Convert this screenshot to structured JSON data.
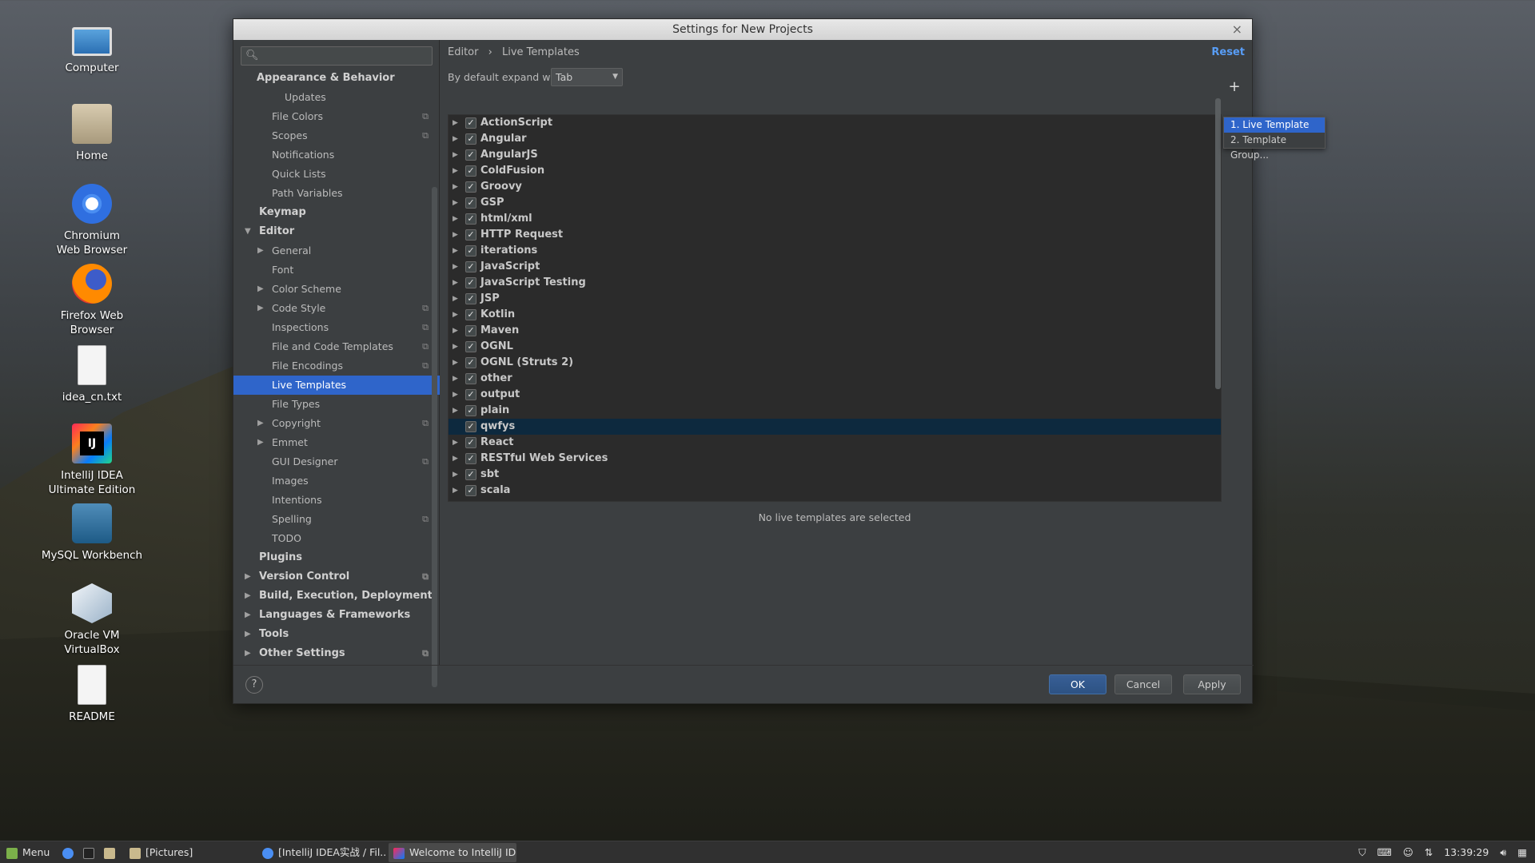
{
  "desktop": {
    "icons": [
      {
        "label": "Computer",
        "icon": "computer-icon"
      },
      {
        "label": "Home",
        "icon": "home-folder-icon"
      },
      {
        "label": "Chromium Web Browser",
        "icon": "chromium-icon"
      },
      {
        "label": "Firefox Web Browser",
        "icon": "firefox-icon"
      },
      {
        "label": "idea_cn.txt",
        "icon": "text-file-icon"
      },
      {
        "label": "IntelliJ IDEA Ultimate Edition",
        "icon": "intellij-icon"
      },
      {
        "label": "MySQL Workbench",
        "icon": "mysql-workbench-icon"
      },
      {
        "label": "Oracle VM VirtualBox",
        "icon": "virtualbox-icon"
      },
      {
        "label": "README",
        "icon": "text-file-icon"
      }
    ]
  },
  "dialog": {
    "title": "Settings for New Projects",
    "close_glyph": "×",
    "search": {
      "placeholder": ""
    },
    "tree": {
      "appearance": "Appearance & Behavior",
      "updates": "Updates",
      "file_colors": "File Colors",
      "scopes": "Scopes",
      "notifications": "Notifications",
      "quick_lists": "Quick Lists",
      "path_variables": "Path Variables",
      "keymap": "Keymap",
      "editor": "Editor",
      "general": "General",
      "font": "Font",
      "color_scheme": "Color Scheme",
      "code_style": "Code Style",
      "inspections": "Inspections",
      "file_code_templates": "File and Code Templates",
      "file_encodings": "File Encodings",
      "live_templates": "Live Templates",
      "file_types": "File Types",
      "copyright": "Copyright",
      "emmet": "Emmet",
      "gui_designer": "GUI Designer",
      "images": "Images",
      "intentions": "Intentions",
      "spelling": "Spelling",
      "todo": "TODO",
      "plugins": "Plugins",
      "version_control": "Version Control",
      "build": "Build, Execution, Deployment",
      "languages": "Languages & Frameworks",
      "tools": "Tools",
      "other_settings": "Other Settings"
    },
    "breadcrumb": {
      "part1": "Editor",
      "sep": "›",
      "part2": "Live Templates"
    },
    "reset_label": "Reset",
    "expand_label": "By default expand with",
    "expand_value": "Tab",
    "groups": [
      "ActionScript",
      "Angular",
      "AngularJS",
      "ColdFusion",
      "Groovy",
      "GSP",
      "html/xml",
      "HTTP Request",
      "iterations",
      "JavaScript",
      "JavaScript Testing",
      "JSP",
      "Kotlin",
      "Maven",
      "OGNL",
      "OGNL (Struts 2)",
      "other",
      "output",
      "plain",
      "qwfys",
      "React",
      "RESTful Web Services",
      "sbt",
      "scala"
    ],
    "selected_group": "qwfys",
    "checked": true,
    "add_button": "+",
    "popup": {
      "item1": "1. Live Template",
      "item2": "2. Template Group..."
    },
    "empty_message": "No live templates are selected",
    "help_label": "?",
    "ok_label": "OK",
    "cancel_label": "Cancel",
    "apply_label": "Apply",
    "colors": {
      "selection": "#2f65ca",
      "link": "#589df6",
      "background": "#3c3f41"
    }
  },
  "taskbar": {
    "menu_label": "Menu",
    "items": [
      "[Pictures]",
      "[IntelliJ IDEA实战 / Fil...",
      "Welcome to IntelliJ ID..."
    ],
    "clock": "13:39:29"
  }
}
